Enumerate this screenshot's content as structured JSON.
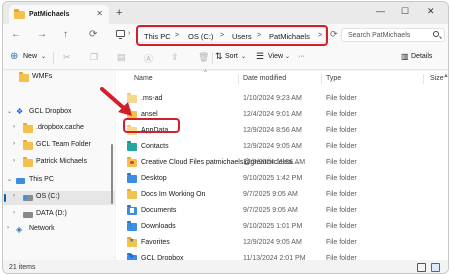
{
  "window": {
    "tab_title": "PatMichaels",
    "tab_close": "✕",
    "new_tab": "+",
    "minimize": "—",
    "maximize": "☐",
    "close": "✕"
  },
  "nav": {
    "back": "←",
    "forward": "→",
    "up": "↑",
    "refresh": "⟳"
  },
  "breadcrumb": {
    "items": [
      "This PC",
      "OS (C:)",
      "Users",
      "PatMichaels"
    ],
    "separator": ">"
  },
  "search": {
    "placeholder": "Search PatMichaels"
  },
  "commandbar": {
    "new_label": "New",
    "sort_label": "Sort",
    "view_label": "View",
    "more": "···",
    "details_label": "Details"
  },
  "sidebar": {
    "items": [
      {
        "label": "WMFs",
        "icon": "folder-icon"
      },
      {
        "label": "GCL Dropbox",
        "icon": "dropbox-icon"
      },
      {
        "label": ".dropbox.cache",
        "icon": "folder-icon"
      },
      {
        "label": "GCL Team Folder",
        "icon": "folder-icon"
      },
      {
        "label": "Patrick Michaels",
        "icon": "folder-icon"
      },
      {
        "label": "This PC",
        "icon": "pc-icon"
      },
      {
        "label": "OS (C:)",
        "icon": "drive-icon"
      },
      {
        "label": "DATA (D:)",
        "icon": "drive-icon"
      },
      {
        "label": "Network",
        "icon": "network-icon"
      }
    ]
  },
  "columns": {
    "name": "Name",
    "date": "Date modified",
    "type": "Type",
    "size": "Size"
  },
  "files": [
    {
      "name": ".ms-ad",
      "date": "1/10/2024 9:23 AM",
      "type": "File folder",
      "icon": "dim"
    },
    {
      "name": "ansel",
      "date": "12/4/2024 9:01 AM",
      "type": "File folder",
      "icon": "plain"
    },
    {
      "name": "AppData",
      "date": "12/9/2024 8:56 AM",
      "type": "File folder",
      "icon": "dim"
    },
    {
      "name": "Contacts",
      "date": "12/9/2024 9:05 AM",
      "type": "File folder",
      "icon": "teal"
    },
    {
      "name": "Creative Cloud Files  patmichaels@greatcirclelea...",
      "date": "12/9/2024 11:26 AM",
      "type": "File folder",
      "icon": "cc"
    },
    {
      "name": "Desktop",
      "date": "9/10/2025 1:42 PM",
      "type": "File folder",
      "icon": "blue"
    },
    {
      "name": "Docs Im Working On",
      "date": "9/7/2025 9:05 AM",
      "type": "File folder",
      "icon": "plain"
    },
    {
      "name": "Documents",
      "date": "9/7/2025 9:05 AM",
      "type": "File folder",
      "icon": "doc"
    },
    {
      "name": "Downloads",
      "date": "9/10/2025 1:01 PM",
      "type": "File folder",
      "icon": "dl"
    },
    {
      "name": "Favorites",
      "date": "12/9/2024 9:05 AM",
      "type": "File folder",
      "icon": "fav"
    },
    {
      "name": "GCL Dropbox",
      "date": "11/13/2024 2:01 PM",
      "type": "File folder",
      "icon": "dbxf"
    }
  ],
  "status": {
    "item_count": "21 items"
  },
  "colors": {
    "highlight_red": "#d21f2b",
    "folder_yellow": "#f2c14e",
    "accent_blue": "#005fb8"
  }
}
